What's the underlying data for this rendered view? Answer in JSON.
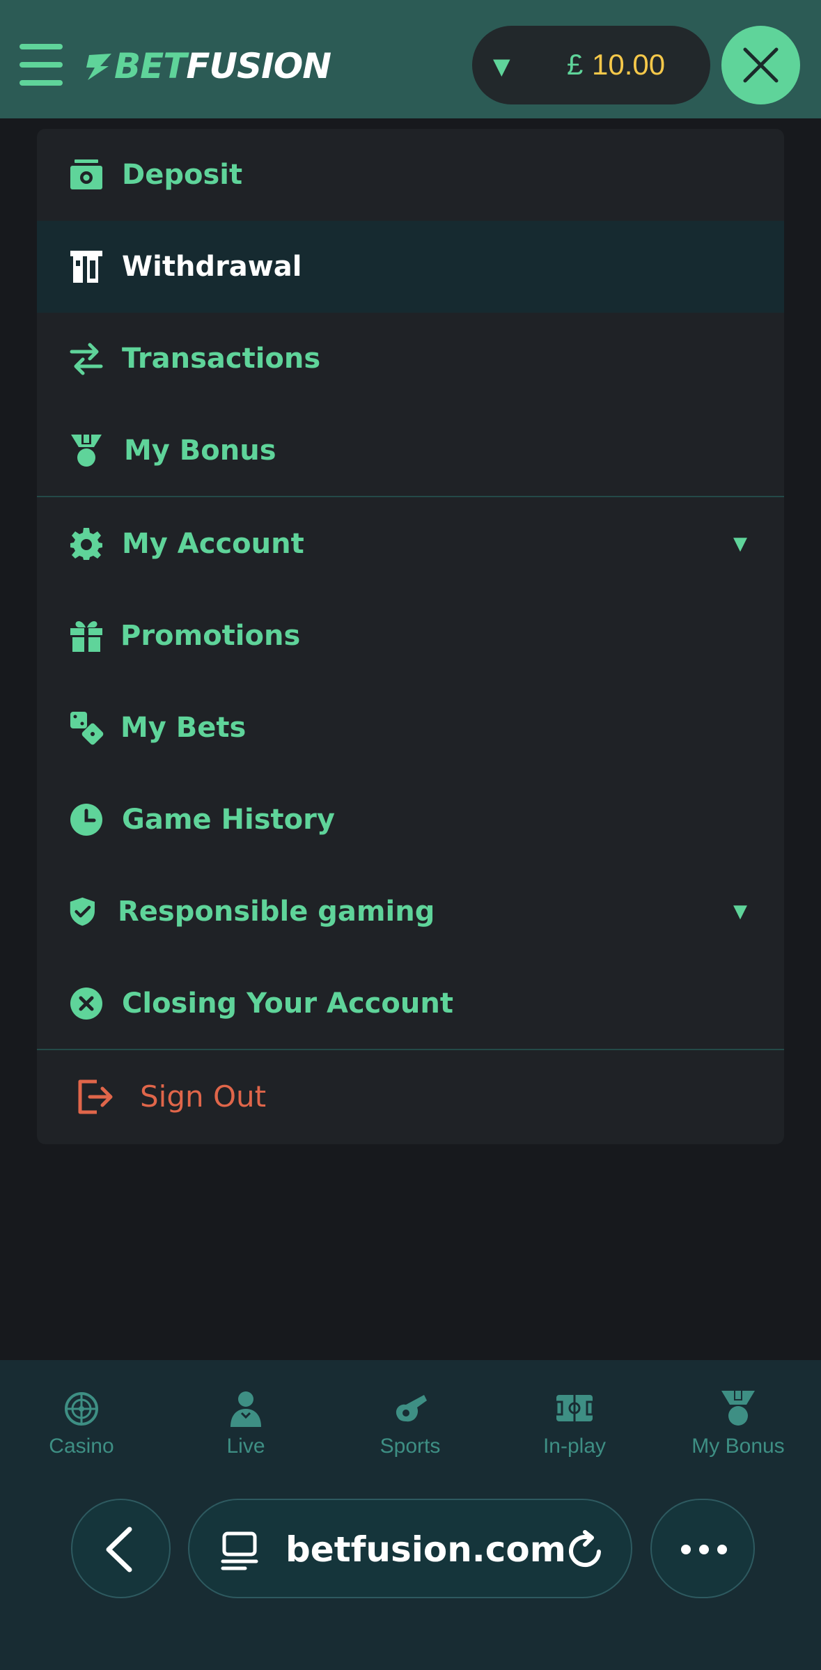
{
  "header": {
    "logo": {
      "part1": "BET",
      "part2": "FUSION"
    },
    "balance": {
      "currency": "£",
      "amount": "10.00"
    }
  },
  "menu": {
    "items": [
      {
        "label": "Deposit",
        "icon": "cash-icon",
        "active": false
      },
      {
        "label": "Withdrawal",
        "icon": "atm-icon",
        "active": true
      },
      {
        "label": "Transactions",
        "icon": "transfer-arrows-icon",
        "active": false
      },
      {
        "label": "My Bonus",
        "icon": "medal-icon",
        "active": false
      },
      {
        "label": "My Account",
        "icon": "gear-icon",
        "active": false,
        "expandable": true
      },
      {
        "label": "Promotions",
        "icon": "gift-icon",
        "active": false
      },
      {
        "label": "My Bets",
        "icon": "dice-icon",
        "active": false
      },
      {
        "label": "Game History",
        "icon": "clock-icon",
        "active": false
      },
      {
        "label": "Responsible gaming",
        "icon": "shield-check-icon",
        "active": false,
        "expandable": true
      },
      {
        "label": "Closing Your Account",
        "icon": "close-circle-icon",
        "active": false
      }
    ],
    "signout": {
      "label": "Sign Out",
      "icon": "sign-out-icon"
    }
  },
  "bottom_nav": {
    "items": [
      {
        "label": "Casino",
        "icon": "roulette-icon"
      },
      {
        "label": "Live",
        "icon": "dealer-icon"
      },
      {
        "label": "Sports",
        "icon": "whistle-icon"
      },
      {
        "label": "In-play",
        "icon": "field-icon"
      },
      {
        "label": "My Bonus",
        "icon": "medal-icon"
      }
    ]
  },
  "browser": {
    "url": "betfusion.com"
  },
  "colors": {
    "header_bg": "#2c5b55",
    "accent_green": "#5fd49a",
    "balance_gold": "#f5c84a",
    "menu_bg": "#1f2226",
    "active_row_bg": "#162a30",
    "sign_out_red": "#e0664a",
    "bottom_nav_bg": "#182c33",
    "nav_label": "#3e8f84"
  }
}
